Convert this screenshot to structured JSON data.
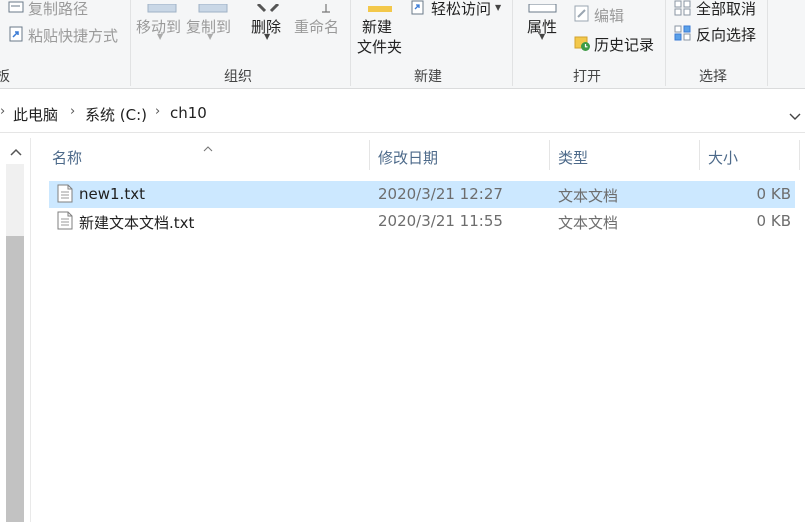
{
  "ribbon": {
    "clipboard": {
      "copy_path": "复制路径",
      "paste_shortcut": "粘贴快捷方式",
      "group_label_fragment": "板"
    },
    "organize": {
      "move_to": "移动到",
      "copy_to": "复制到",
      "delete": "删除",
      "rename": "重命名",
      "group_label": "组织"
    },
    "new": {
      "new_folder_line1": "新建",
      "new_folder_line2": "文件夹",
      "easy_access": "轻松访问",
      "group_label": "新建"
    },
    "open": {
      "properties": "属性",
      "edit": "编辑",
      "history": "历史记录",
      "group_label": "打开"
    },
    "select": {
      "select_none": "全部取消",
      "invert_selection": "反向选择",
      "group_label": "选择"
    }
  },
  "address": {
    "crumbs": [
      "此电脑",
      "系统 (C:)",
      "ch10"
    ]
  },
  "columns": {
    "name": "名称",
    "modified": "修改日期",
    "type": "类型",
    "size": "大小"
  },
  "files": [
    {
      "name": "new1.txt",
      "modified": "2020/3/21 12:27",
      "type": "文本文档",
      "size": "0 KB",
      "selected": true
    },
    {
      "name": "新建文本文档.txt",
      "modified": "2020/3/21 11:55",
      "type": "文本文档",
      "size": "0 KB",
      "selected": false
    }
  ],
  "colors": {
    "selection": "#cce8ff",
    "header_text": "#4d6a8a",
    "ribbon_bg": "#f5f6f7"
  }
}
